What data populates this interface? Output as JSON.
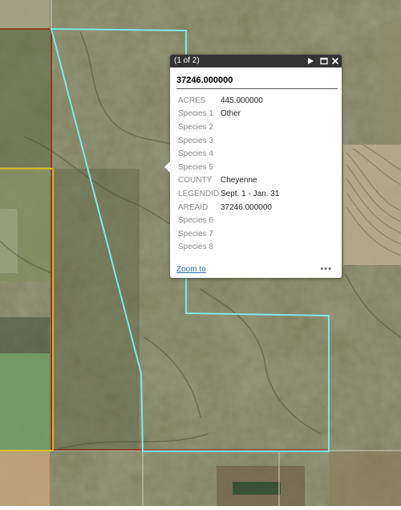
{
  "popup": {
    "count_label": "(1 of 2)",
    "title": "37246.000000",
    "zoom_label": "Zoom to",
    "more_label": "•••",
    "attributes": [
      {
        "name": "ACRES",
        "value": "445.000000"
      },
      {
        "name": "Species 1",
        "value": "Other"
      },
      {
        "name": "Species 2",
        "value": ""
      },
      {
        "name": "Species 3",
        "value": ""
      },
      {
        "name": "Species 4",
        "value": ""
      },
      {
        "name": "Species 5",
        "value": ""
      },
      {
        "name": "COUNTY",
        "value": "Cheyenne"
      },
      {
        "name": "LEGENDID",
        "value": "Sept. 1 - Jan. 31"
      },
      {
        "name": "AREAID",
        "value": "37246.000000"
      },
      {
        "name": "Species 6",
        "value": ""
      },
      {
        "name": "Species 7",
        "value": ""
      },
      {
        "name": "Species 8",
        "value": ""
      }
    ]
  },
  "colors": {
    "selected_parcel": "#7fe8e4",
    "parcel_red": "#8b2a12",
    "parcel_yellow": "#e8c70b",
    "popup_header": "#333333",
    "link": "#2a6fb0"
  }
}
